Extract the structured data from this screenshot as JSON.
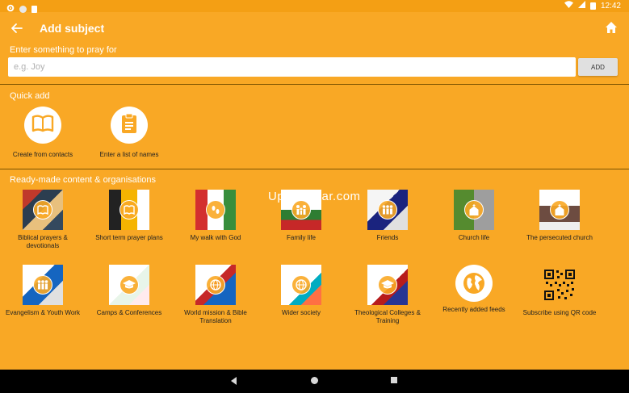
{
  "status": {
    "time": "12:42"
  },
  "appbar": {
    "title": "Add subject"
  },
  "entry": {
    "prompt": "Enter something to pray for",
    "placeholder": "e.g. Joy",
    "value": "",
    "add_label": "ADD"
  },
  "quick_add": {
    "title": "Quick add",
    "items": [
      {
        "label": "Create from contacts",
        "icon": "book-icon"
      },
      {
        "label": "Enter a list of names",
        "icon": "clipboard-icon"
      }
    ]
  },
  "ready_made": {
    "title": "Ready-made content & organisations",
    "items": [
      {
        "label": "Biblical prayers & devotionals",
        "overlay": "book-icon"
      },
      {
        "label": "Short term prayer plans",
        "overlay": "book-icon"
      },
      {
        "label": "My walk with God",
        "overlay": "footsteps-icon"
      },
      {
        "label": "Family life",
        "overlay": "family-icon"
      },
      {
        "label": "Friends",
        "overlay": "people-icon"
      },
      {
        "label": "Church life",
        "overlay": "church-icon"
      },
      {
        "label": "The persecuted church",
        "overlay": "church-icon"
      },
      {
        "label": "Evangelism & Youth Work",
        "overlay": "people-icon"
      },
      {
        "label": "Camps & Conferences",
        "overlay": "graduation-cap-icon"
      },
      {
        "label": "World mission & Bible Translation",
        "overlay": "globe-icon"
      },
      {
        "label": "Wider society",
        "overlay": "globe-icon"
      },
      {
        "label": "Theological Colleges & Training",
        "overlay": "graduation-cap-icon"
      },
      {
        "label": "Recently added feeds",
        "overlay": "globe-icon"
      },
      {
        "label": "Subscribe using QR code",
        "overlay": "qr-code-icon"
      }
    ]
  },
  "watermark": "UpdateStar.com",
  "colors": {
    "accent": "#F9A825",
    "statusbar": "#F49F14",
    "navbar": "#000000"
  }
}
